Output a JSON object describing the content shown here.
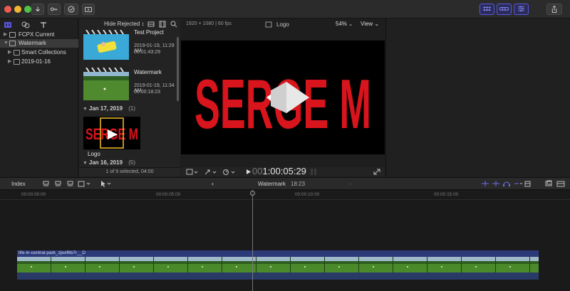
{
  "toolbar": {
    "import_icon": "down-arrow-icon",
    "keywords_icon": "key-icon",
    "check_icon": "checkmark-icon",
    "background_tasks_icon": "background-tasks-icon",
    "share_icon": "share-icon"
  },
  "library": {
    "items": [
      {
        "label": "FCPX Current",
        "selected": false
      },
      {
        "label": "Watermark",
        "selected": true
      },
      {
        "label": "Smart Collections",
        "selected": false
      },
      {
        "label": "2019-01-16",
        "selected": false
      }
    ]
  },
  "browser": {
    "filter_label": "Hide Rejected ↕",
    "clips": [
      {
        "name": "Test Project",
        "date": "2019-01-19, 11:29 AM",
        "duration": "00:01:43:29"
      },
      {
        "name": "Watermark",
        "date": "2019-01-19, 11:34 AM",
        "duration": "00:00:18:23"
      }
    ],
    "group1": {
      "label": "Jan 17, 2019",
      "count": "(1)"
    },
    "logo_clip": {
      "name": "Logo"
    },
    "group2": {
      "label": "Jan 16, 2019",
      "count": "(5)"
    },
    "status": "1 of 9 selected, 04:00"
  },
  "viewer": {
    "format": "1920 × 1080 | 60 fps",
    "clip_name": "Logo",
    "zoom": "54%",
    "zoom_chevron": "⌄",
    "view_label": "View ⌄",
    "logo_text": "SERGE M",
    "timecode": "1:00:05:29",
    "timecode_prefix": "00"
  },
  "timeline": {
    "index_label": "Index",
    "project_name": "Watermark",
    "project_duration": "18:23",
    "ruler": [
      "00:00:00:00",
      "00:00:05:00",
      "00:00:10:00",
      "00:00:15:00"
    ],
    "clip_label": "life-in-central-park_zjexf6b7r__D",
    "colors": {
      "accent": "#5b57e0",
      "logo_red": "#d8141c",
      "clip_top": "#2c3a7a",
      "grass": "#3e7a22"
    }
  }
}
